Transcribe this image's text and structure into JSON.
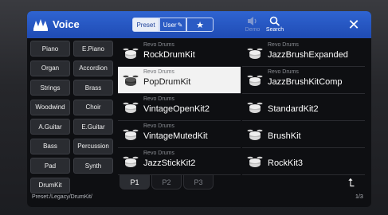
{
  "window": {
    "title": "Voice"
  },
  "toolbar": {
    "preset_label": "Preset",
    "user_label": "User",
    "demo_label": "Demo",
    "search_label": "Search"
  },
  "categories": [
    "Piano",
    "E.Piano",
    "Organ",
    "Accordion",
    "Strings",
    "Brass",
    "Woodwind",
    "Choir",
    "A.Guitar",
    "E.Guitar",
    "Bass",
    "Percussion",
    "Pad",
    "Synth",
    "DrumKit"
  ],
  "voices": [
    {
      "category": "Revo Drums",
      "name": "RockDrumKit",
      "selected": false
    },
    {
      "category": "Revo Drums",
      "name": "JazzBrushExpanded",
      "selected": false
    },
    {
      "category": "Revo Drums",
      "name": "PopDrumKit",
      "selected": true
    },
    {
      "category": "Revo Drums",
      "name": "JazzBrushKitComp",
      "selected": false
    },
    {
      "category": "Revo Drums",
      "name": "VintageOpenKit2",
      "selected": false
    },
    {
      "category": "",
      "name": "StandardKit2",
      "selected": false
    },
    {
      "category": "Revo Drums",
      "name": "VintageMutedKit",
      "selected": false
    },
    {
      "category": "",
      "name": "BrushKit",
      "selected": false
    },
    {
      "category": "Revo Drums",
      "name": "JazzStickKit2",
      "selected": false
    },
    {
      "category": "",
      "name": "RockKit3",
      "selected": false
    }
  ],
  "pages": [
    "P1",
    "P2",
    "P3"
  ],
  "active_page": "P1",
  "status": {
    "path": "Preset:/Legacy/DrumKit/",
    "page_count": "1/3"
  },
  "colors": {
    "titlebar": "#2f64d1",
    "selected_row": "#f2f2f2"
  }
}
